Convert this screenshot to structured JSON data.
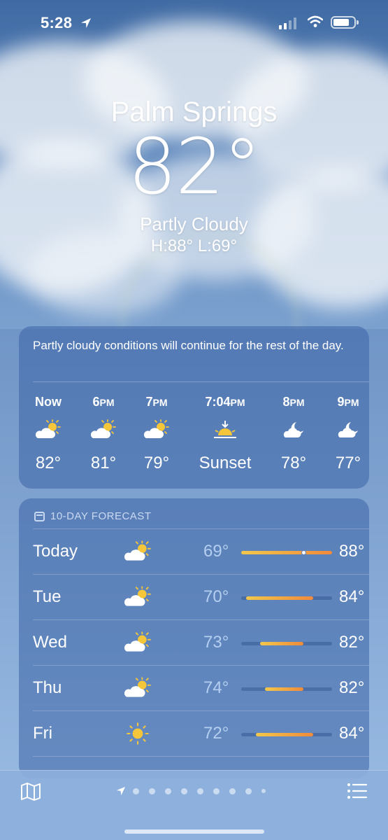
{
  "status_bar": {
    "time": "5:28"
  },
  "location": {
    "city": "Palm Springs",
    "temperature": "82°",
    "condition": "Partly Cloudy",
    "high_low": "H:88°  L:69°"
  },
  "hourly": {
    "summary": "Partly cloudy conditions will continue for the rest of the day.",
    "items": [
      {
        "time": "Now",
        "suffix": "",
        "icon": "partly-sunny-icon",
        "value": "82°"
      },
      {
        "time": "6",
        "suffix": "PM",
        "icon": "partly-sunny-icon",
        "value": "81°"
      },
      {
        "time": "7",
        "suffix": "PM",
        "icon": "partly-sunny-icon",
        "value": "79°"
      },
      {
        "time": "7:04",
        "suffix": "PM",
        "icon": "sunset-icon",
        "value": "Sunset"
      },
      {
        "time": "8",
        "suffix": "PM",
        "icon": "partly-cloudy-night-icon",
        "value": "78°"
      },
      {
        "time": "9",
        "suffix": "PM",
        "icon": "partly-cloudy-night-icon",
        "value": "77°"
      }
    ]
  },
  "ten_day": {
    "heading": "10-DAY FORECAST",
    "range_min": 69,
    "range_max": 88,
    "current_temp": 82,
    "days": [
      {
        "day": "Today",
        "icon": "partly-sunny-icon",
        "low": "69°",
        "high": "88°",
        "low_v": 69,
        "high_v": 88
      },
      {
        "day": "Tue",
        "icon": "partly-sunny-icon",
        "low": "70°",
        "high": "84°",
        "low_v": 70,
        "high_v": 84
      },
      {
        "day": "Wed",
        "icon": "partly-sunny-icon",
        "low": "73°",
        "high": "82°",
        "low_v": 73,
        "high_v": 82
      },
      {
        "day": "Thu",
        "icon": "partly-sunny-icon",
        "low": "74°",
        "high": "82°",
        "low_v": 74,
        "high_v": 82
      },
      {
        "day": "Fri",
        "icon": "sun-icon",
        "low": "72°",
        "high": "84°",
        "low_v": 72,
        "high_v": 84
      }
    ]
  },
  "colors": {
    "sun": "#f5c63a",
    "bar_cool": "#f2c84b",
    "bar_warm": "#f08a3a"
  }
}
